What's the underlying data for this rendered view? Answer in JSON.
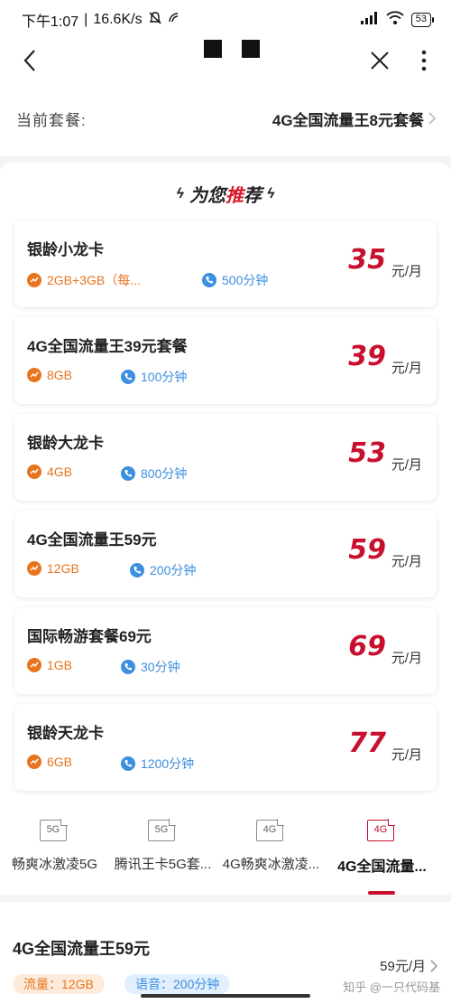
{
  "status_bar": {
    "time": "下午1:07",
    "speed": "16.6K/s",
    "battery": "53"
  },
  "current_plan": {
    "label": "当前套餐:",
    "value": "4G全国流量王8元套餐"
  },
  "recommend": {
    "title_part1": "为您",
    "title_highlight": "推",
    "title_part2": "荐"
  },
  "plans": [
    {
      "name": "银龄小龙卡",
      "data": "2GB+3GB（每...",
      "voice": "500分钟",
      "price": "35",
      "unit": "元/月"
    },
    {
      "name": "4G全国流量王39元套餐",
      "data": "8GB",
      "voice": "100分钟",
      "price": "39",
      "unit": "元/月"
    },
    {
      "name": "银龄大龙卡",
      "data": "4GB",
      "voice": "800分钟",
      "price": "53",
      "unit": "元/月"
    },
    {
      "name": "4G全国流量王59元",
      "data": "12GB",
      "voice": "200分钟",
      "price": "59",
      "unit": "元/月"
    },
    {
      "name": "国际畅游套餐69元",
      "data": "1GB",
      "voice": "30分钟",
      "price": "69",
      "unit": "元/月"
    },
    {
      "name": "银龄天龙卡",
      "data": "6GB",
      "voice": "1200分钟",
      "price": "77",
      "unit": "元/月"
    }
  ],
  "tabs": [
    {
      "icon_text": "5G",
      "label": "畅爽冰激凌5G"
    },
    {
      "icon_text": "5G",
      "label": "腾讯王卡5G套..."
    },
    {
      "icon_text": "4G",
      "label": "4G畅爽冰激凌..."
    },
    {
      "icon_text": "4G",
      "label": "4G全国流量..."
    }
  ],
  "detail": {
    "name": "4G全国流量王59元",
    "price": "59元/月",
    "data_chip": "流量：12GB",
    "voice_chip": "语音：200分钟",
    "watermark": "知乎 @一只代码基"
  },
  "colors": {
    "accent": "#c8102e",
    "data": "#e8741e",
    "voice": "#3d8fe0"
  }
}
